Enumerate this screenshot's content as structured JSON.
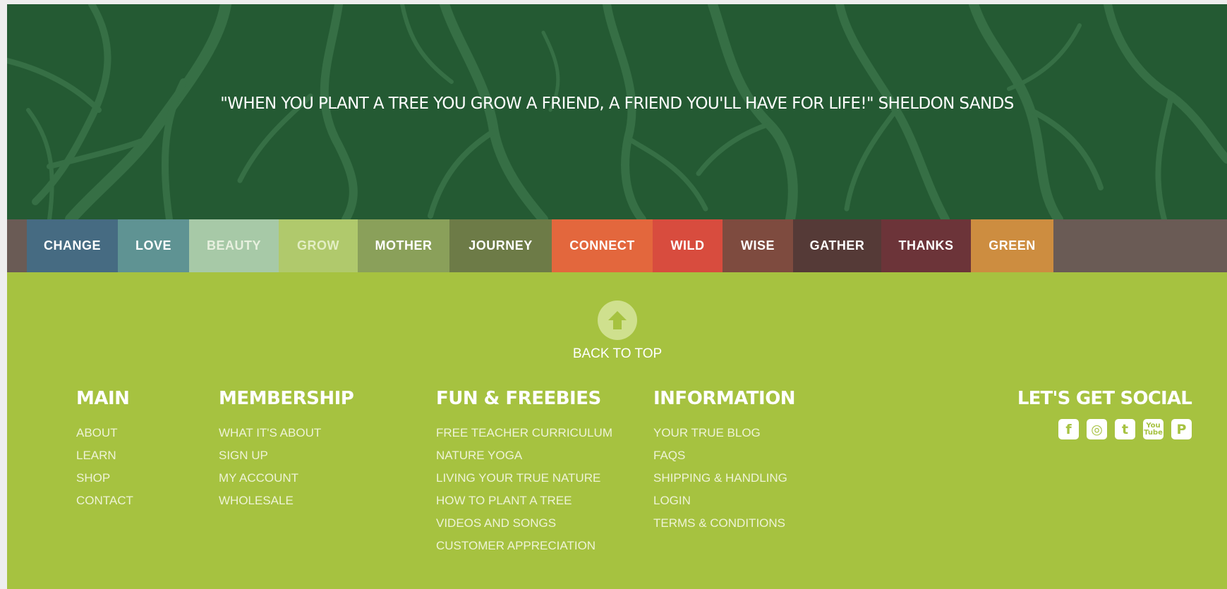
{
  "hero": {
    "quote": "\"WHEN YOU PLANT A TREE YOU GROW A FRIEND, A FRIEND YOU'LL HAVE FOR LIFE!\" SHELDON SANDS",
    "background_color": "#245a33",
    "pattern_color": "#3f7a4e"
  },
  "wordbar": {
    "items": [
      {
        "label": "CHANGE",
        "color": "#466b82",
        "text_color": "#ffffff"
      },
      {
        "label": "LOVE",
        "color": "#5f9393",
        "text_color": "#ffffff"
      },
      {
        "label": "BEAUTY",
        "color": "#a7c9a7",
        "text_color": "#e7f0df"
      },
      {
        "label": "GROW",
        "color": "#b0c96c",
        "text_color": "#e3eec4"
      },
      {
        "label": "MOTHER",
        "color": "#8aa05a",
        "text_color": "#ffffff"
      },
      {
        "label": "JOURNEY",
        "color": "#6d7b47",
        "text_color": "#ffffff"
      },
      {
        "label": "CONNECT",
        "color": "#e3673d",
        "text_color": "#ffffff"
      },
      {
        "label": "WILD",
        "color": "#d84c3e",
        "text_color": "#ffffff"
      },
      {
        "label": "WISE",
        "color": "#7e4b3f",
        "text_color": "#ffffff"
      },
      {
        "label": "GATHER",
        "color": "#553a37",
        "text_color": "#ffffff"
      },
      {
        "label": "THANKS",
        "color": "#6c3439",
        "text_color": "#ffffff"
      },
      {
        "label": "GREEN",
        "color": "#cd8d40",
        "text_color": "#ffffff"
      }
    ]
  },
  "footer": {
    "background_color": "#a6c240",
    "back_to_top": "BACK TO TOP",
    "columns": [
      {
        "heading": "MAIN",
        "links": [
          "ABOUT",
          "LEARN",
          "SHOP",
          "CONTACT"
        ]
      },
      {
        "heading": "MEMBERSHIP",
        "links": [
          "WHAT IT'S ABOUT",
          "SIGN UP",
          "MY ACCOUNT",
          "WHOLESALE"
        ]
      },
      {
        "heading": "FUN & FREEBIES",
        "links": [
          "FREE TEACHER CURRICULUM",
          "NATURE YOGA",
          "LIVING YOUR TRUE NATURE",
          "HOW TO PLANT A TREE",
          "VIDEOS AND SONGS",
          "CUSTOMER APPRECIATION"
        ]
      },
      {
        "heading": "INFORMATION",
        "links": [
          "YOUR TRUE BLOG",
          "FAQS",
          "SHIPPING & HANDLING",
          "LOGIN",
          "TERMS & CONDITIONS"
        ]
      }
    ],
    "social": {
      "heading": "LET'S GET SOCIAL",
      "icons": [
        {
          "name": "facebook-icon",
          "glyph": "f"
        },
        {
          "name": "instagram-icon",
          "glyph": "◎"
        },
        {
          "name": "twitter-icon",
          "glyph": "t"
        },
        {
          "name": "youtube-icon",
          "glyph_top": "You",
          "glyph_bottom": "Tube"
        },
        {
          "name": "pinterest-icon",
          "glyph": "P"
        }
      ]
    }
  }
}
